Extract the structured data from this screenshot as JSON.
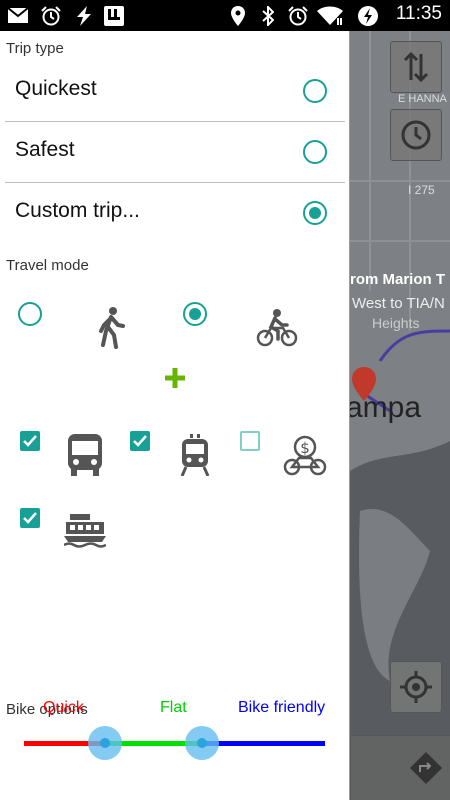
{
  "status_bar": {
    "time": "11:35",
    "left_icons": [
      "mail-icon",
      "alarm-icon",
      "flash-icon",
      "app-icon"
    ],
    "right_icons": [
      "location-icon",
      "bluetooth-icon",
      "alarm-icon",
      "wifi-icon",
      "data-saver-icon"
    ]
  },
  "trip_type": {
    "label": "Trip type",
    "options": [
      {
        "label": "Quickest",
        "selected": false
      },
      {
        "label": "Safest",
        "selected": false
      },
      {
        "label": "Custom trip...",
        "selected": true
      }
    ]
  },
  "travel_mode": {
    "label": "Travel mode",
    "walk": {
      "icon": "walk-icon",
      "selected": false
    },
    "bike": {
      "icon": "bike-icon",
      "selected": true
    },
    "plus_icon": "plus-icon",
    "transit": [
      {
        "icon": "bus-icon",
        "checked": true
      },
      {
        "icon": "train-icon",
        "checked": true
      },
      {
        "icon": "bikeshare-icon",
        "checked": false
      },
      {
        "icon": "ferry-icon",
        "checked": true
      }
    ]
  },
  "bike_options": {
    "label": "Bike options",
    "slider": {
      "labels": [
        "Quick",
        "Flat",
        "Bike friendly"
      ],
      "colors": [
        "#ff0000",
        "#00e000",
        "#0000ff"
      ],
      "thumb1_fraction": 0.27,
      "thumb2_fraction": 0.59
    }
  },
  "map": {
    "labels": [
      "E HANNA",
      "I 275",
      "rom Marion T",
      "West to TIA/N",
      "Heights",
      "ampa"
    ],
    "icons": [
      "directions-icon",
      "clock-icon",
      "my-location-icon",
      "navigate-icon"
    ]
  }
}
